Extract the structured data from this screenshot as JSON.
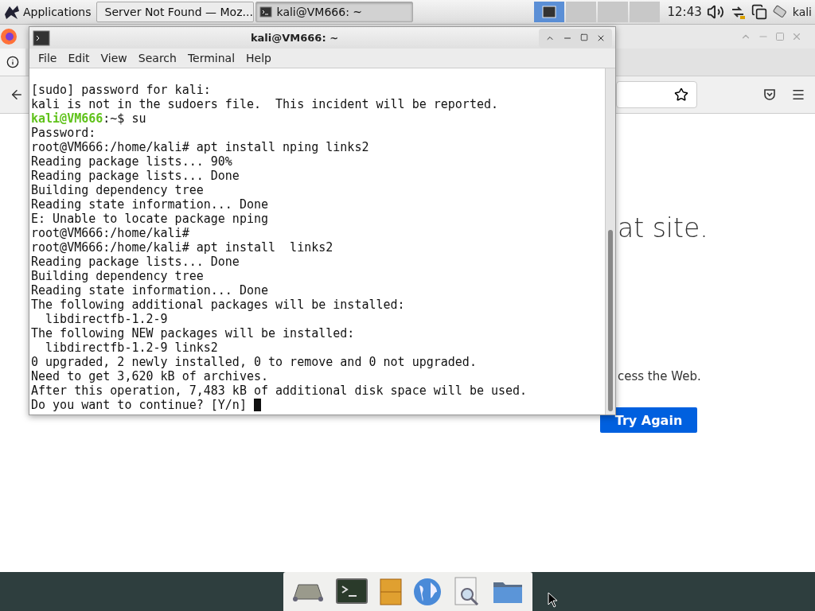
{
  "panel": {
    "apps_menu": "Applications",
    "tasks": [
      {
        "title": "Server Not Found — Moz...",
        "selected": false
      },
      {
        "title": "kali@VM666: ~",
        "selected": true
      }
    ],
    "workspaces": [
      {
        "selected": true
      },
      {
        "selected": false
      },
      {
        "selected": false
      },
      {
        "selected": false
      }
    ],
    "clock": "12:43",
    "user": "kali"
  },
  "browser": {
    "heading": "at site.",
    "message": "cess the Web.",
    "button": "Try Again"
  },
  "terminal": {
    "title": "kali@VM666: ~",
    "menu": [
      "File",
      "Edit",
      "View",
      "Search",
      "Terminal",
      "Help"
    ],
    "lines": [
      {
        "kind": "text",
        "text": "[sudo] password for kali:"
      },
      {
        "kind": "text",
        "text": "kali is not in the sudoers file.  This incident will be reported."
      },
      {
        "kind": "user_prompt",
        "user": "kali@VM666",
        "rest": ":~$ su"
      },
      {
        "kind": "text",
        "text": "Password:"
      },
      {
        "kind": "text",
        "text": "root@VM666:/home/kali# apt install nping links2"
      },
      {
        "kind": "text",
        "text": "Reading package lists... 90%"
      },
      {
        "kind": "text",
        "text": "Reading package lists... Done"
      },
      {
        "kind": "text",
        "text": "Building dependency tree"
      },
      {
        "kind": "text",
        "text": "Reading state information... Done"
      },
      {
        "kind": "text",
        "text": "E: Unable to locate package nping"
      },
      {
        "kind": "text",
        "text": "root@VM666:/home/kali#"
      },
      {
        "kind": "text",
        "text": "root@VM666:/home/kali# apt install  links2"
      },
      {
        "kind": "text",
        "text": "Reading package lists... Done"
      },
      {
        "kind": "text",
        "text": "Building dependency tree"
      },
      {
        "kind": "text",
        "text": "Reading state information... Done"
      },
      {
        "kind": "text",
        "text": "The following additional packages will be installed:"
      },
      {
        "kind": "text",
        "text": "  libdirectfb-1.2-9"
      },
      {
        "kind": "text",
        "text": "The following NEW packages will be installed:"
      },
      {
        "kind": "text",
        "text": "  libdirectfb-1.2-9 links2"
      },
      {
        "kind": "text",
        "text": "0 upgraded, 2 newly installed, 0 to remove and 0 not upgraded."
      },
      {
        "kind": "text",
        "text": "Need to get 3,620 kB of archives."
      },
      {
        "kind": "text",
        "text": "After this operation, 7,483 kB of additional disk space will be used."
      },
      {
        "kind": "cursor_line",
        "text": "Do you want to continue? [Y/n] "
      }
    ]
  }
}
